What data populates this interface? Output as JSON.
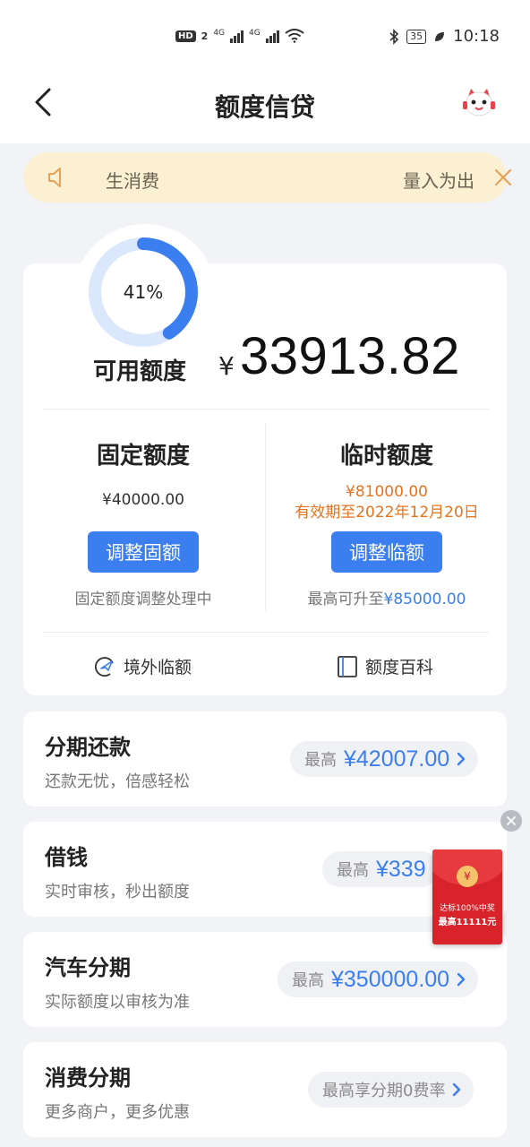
{
  "status_bar": {
    "hd": "HD",
    "sim": "2",
    "net1": "4G",
    "net2": "4G",
    "battery": "35",
    "time": "10:18"
  },
  "header": {
    "title": "额度信贷"
  },
  "notice": {
    "text_left": "​生消费",
    "text_right": "量入为出"
  },
  "credit": {
    "ring_percent_label": "41%",
    "ring_percent_value": 0.41,
    "available_label": "可用额度",
    "currency": "¥",
    "available_amount": "33913.82",
    "fixed": {
      "title": "固定额度",
      "value": "¥40000.00",
      "button": "调整固额",
      "note": "固定额度调整处理中"
    },
    "temp": {
      "title": "临时额度",
      "value": "¥81000.00",
      "validity": "有效期至2022年12月20日",
      "button": "调整临额",
      "note_prefix": "最高可升至",
      "note_value": "¥85000.00"
    },
    "links": {
      "overseas": "境外临额",
      "wiki": "额度百科"
    }
  },
  "products": [
    {
      "title": "分期还款",
      "subtitle": "还款无忧，倍感轻松",
      "pill_label": "最高",
      "pill_value": "¥42007.00"
    },
    {
      "title": "借钱",
      "subtitle": "实时审核，秒出额度",
      "pill_label": "最高",
      "pill_value": "¥339"
    },
    {
      "title": "汽车分期",
      "subtitle": "实际额度以审核为准",
      "pill_label": "最高",
      "pill_value": "¥350000.00"
    },
    {
      "title": "消费分期",
      "subtitle": "更多商户，更多优惠",
      "pill_label": "最高享分期0费率",
      "pill_value": ""
    }
  ],
  "red_packet": {
    "coin": "¥",
    "line1": "达标100%中奖",
    "line2": "最高11111元"
  },
  "colors": {
    "accent": "#3a7ef0",
    "orange": "#e8731e",
    "notice_bg": "#fbf0d2",
    "red_packet": "#d8232a"
  }
}
